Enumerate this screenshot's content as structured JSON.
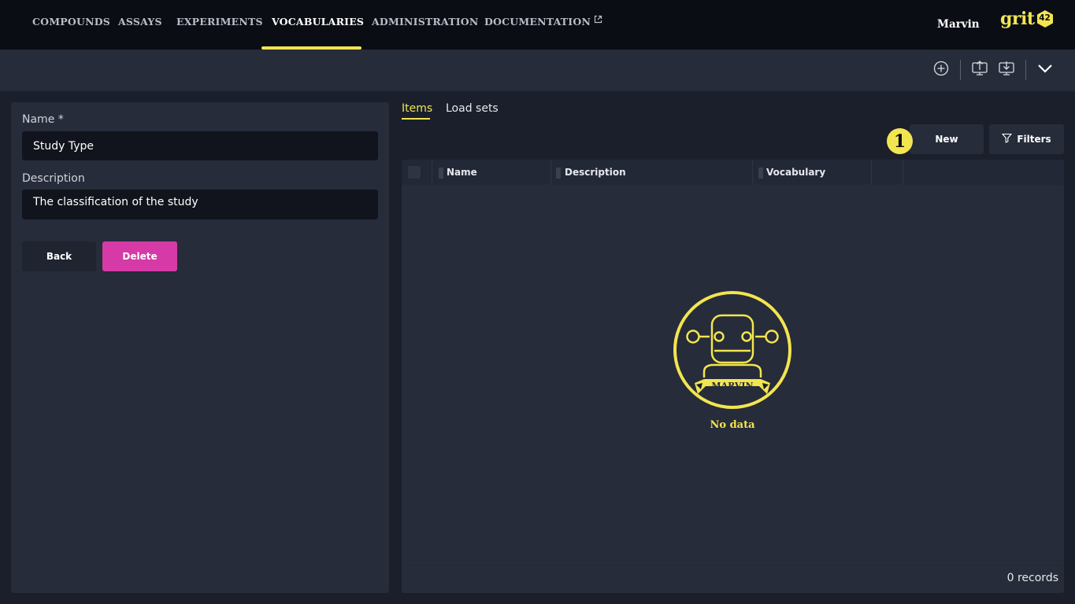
{
  "nav": {
    "items": [
      {
        "label": "COMPOUNDS"
      },
      {
        "label": "ASSAYS"
      },
      {
        "label": "EXPERIMENTS"
      },
      {
        "label": "VOCABULARIES",
        "active": true
      },
      {
        "label": "ADMINISTRATION"
      },
      {
        "label": "DOCUMENTATION",
        "external": true
      }
    ],
    "user": "Marvin",
    "logo_text": "grit",
    "logo_badge": "42"
  },
  "toolbar": {
    "icons": [
      "plus-circle-icon",
      "upload-icon",
      "download-icon",
      "chevron-down-icon"
    ]
  },
  "form": {
    "name_label": "Name *",
    "name_value": "Study Type",
    "description_label": "Description",
    "description_value": "The classification of the study",
    "back_label": "Back",
    "delete_label": "Delete"
  },
  "tabs": [
    {
      "label": "Items",
      "active": true
    },
    {
      "label": "Load sets"
    }
  ],
  "actions": {
    "step_badge": "1",
    "new_label": "New",
    "filters_label": "Filters"
  },
  "grid": {
    "columns": [
      "Name",
      "Description",
      "Vocabulary"
    ],
    "empty_mascot_text": "MARVIN",
    "empty_text": "No data",
    "records": "0 records"
  },
  "colors": {
    "accent": "#f2e550",
    "danger": "#d63aa6",
    "background": "#1a1f2b",
    "panel": "#262c39",
    "nav": "#0b0d14"
  }
}
